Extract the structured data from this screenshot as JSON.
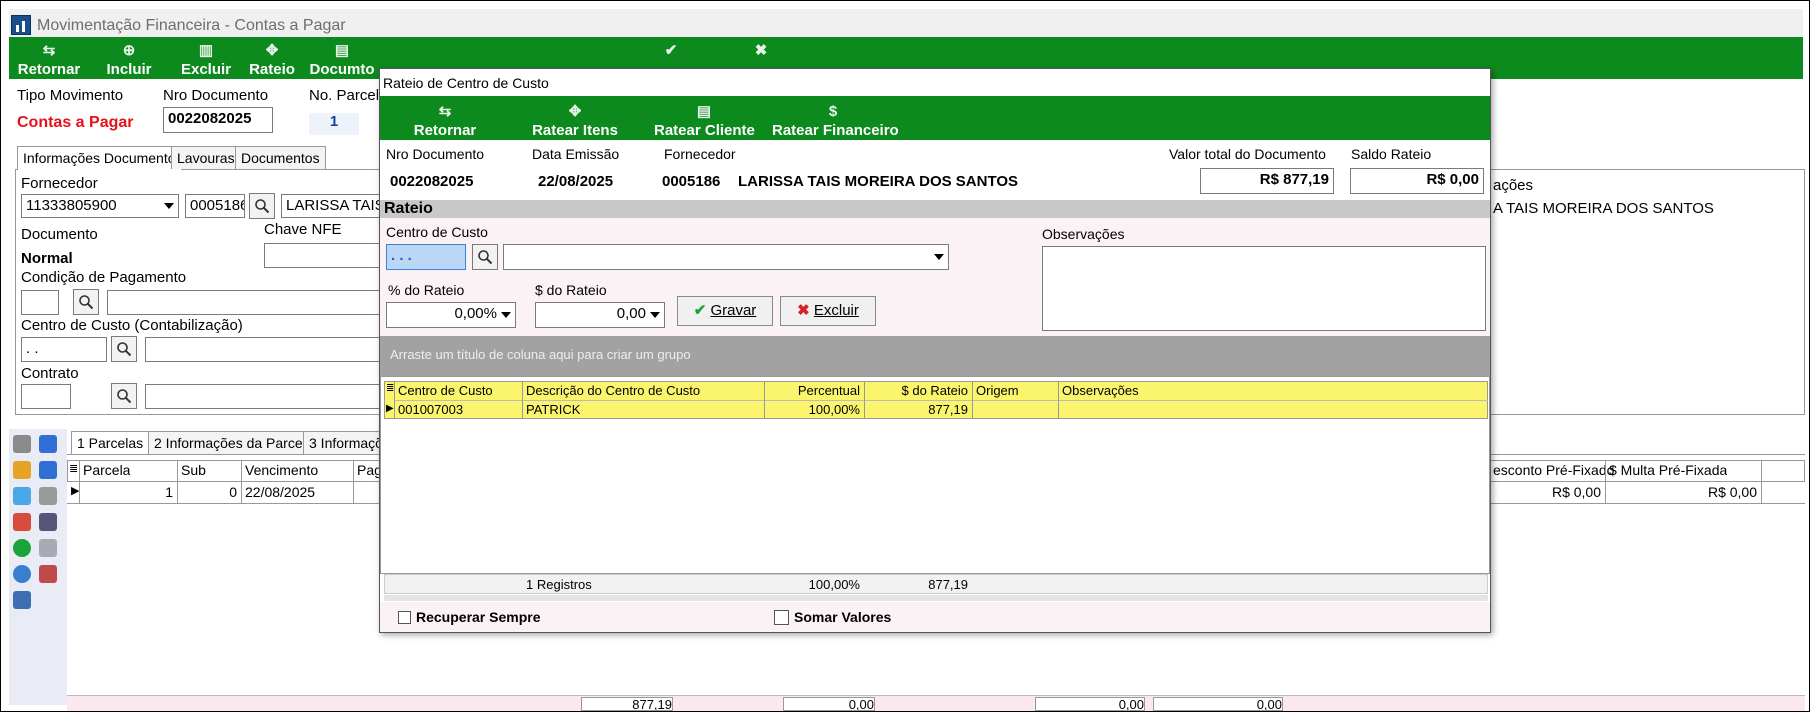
{
  "window": {
    "title": "Movimentação Financeira - Contas a Pagar"
  },
  "toolbar": {
    "items": [
      {
        "label": "Retornar"
      },
      {
        "label": "Incluir"
      },
      {
        "label": "Excluir"
      },
      {
        "label": "Rateio"
      },
      {
        "label": "Documto"
      }
    ]
  },
  "header": {
    "tipo_label": "Tipo Movimento",
    "tipo_value": "Contas a Pagar",
    "nro_label": "Nro Documento",
    "nro_value": "0022082025",
    "parcela_label": "No. Parcela",
    "parcela_value": "1"
  },
  "tabs": [
    "Informações Documento",
    "Lavouras",
    "Documentos"
  ],
  "form": {
    "fornecedor_label": "Fornecedor",
    "fornecedor_cnpj": "11333805900",
    "fornecedor_code": "0005186",
    "fornecedor_name": "LARISSA TAIS I",
    "fornecedor_name_right": "A TAIS MOREIRA DOS SANTOS",
    "observacoes_right": "ações",
    "documento_label": "Documento",
    "documento_value": "Normal",
    "chave_nfe_label": "Chave NFE",
    "condicao_label": "Condição de Pagamento",
    "centro_custo_label": "Centro de Custo (Contabilização)",
    "centro_custo_value": ". .",
    "contrato_label": "Contrato"
  },
  "parcela_tabs": [
    "1 Parcelas",
    "2 Informações da Parcela",
    "3 Informaçõ"
  ],
  "parcelas": {
    "columns": [
      "Parcela",
      "Sub",
      "Vencimento",
      "Pag"
    ],
    "right_columns": [
      "esconto Pré-Fixado",
      "$ Multa Pré-Fixada"
    ],
    "rows": [
      {
        "parcela": "1",
        "sub": "0",
        "vencimento": "22/08/2025",
        "desconto": "R$ 0,00",
        "multa": "R$ 0,00"
      }
    ]
  },
  "footer_totals": [
    "877,19",
    "0,00",
    "0,00",
    "0,00"
  ],
  "modal": {
    "title": "Rateio de Centro de Custo",
    "toolbar": [
      {
        "label": "Retornar"
      },
      {
        "label": "Ratear Itens"
      },
      {
        "label": "Ratear Cliente"
      },
      {
        "label": "Ratear Financeiro"
      }
    ],
    "nro_label": "Nro Documento",
    "nro_value": "0022082025",
    "data_label": "Data Emissão",
    "data_value": "22/08/2025",
    "fornecedor_label": "Fornecedor",
    "fornecedor_code": "0005186",
    "fornecedor_name": "LARISSA TAIS MOREIRA DOS SANTOS",
    "valor_label": "Valor total do Documento",
    "valor_value": "R$ 877,19",
    "saldo_label": "Saldo Rateio",
    "saldo_value": "R$ 0,00",
    "section": "Rateio",
    "centro_label": "Centro de Custo",
    "centro_value": ". . .",
    "observacoes_label": "Observações",
    "pct_label": "% do Rateio",
    "pct_value": "0,00%",
    "valor_rateio_label": "$ do Rateio",
    "valor_rateio_value": "0,00",
    "gravar": "Gravar",
    "excluir": "Excluir",
    "group_hint": "Arraste um título de coluna aqui para criar um grupo",
    "grid_columns": [
      "Centro de Custo",
      "Descrição do Centro de Custo",
      "Percentual",
      "$ do Rateio",
      "Origem",
      "Observações"
    ],
    "grid_rows": [
      {
        "centro": "001007003",
        "descricao": "PATRICK",
        "percentual": "100,00%",
        "rateio": "877,19",
        "origem": "",
        "obs": ""
      }
    ],
    "summary_registros": "1 Registros",
    "summary_pct": "100,00%",
    "summary_valor": "877,19",
    "recuperar": "Recuperar Sempre",
    "somar": "Somar Valores"
  }
}
